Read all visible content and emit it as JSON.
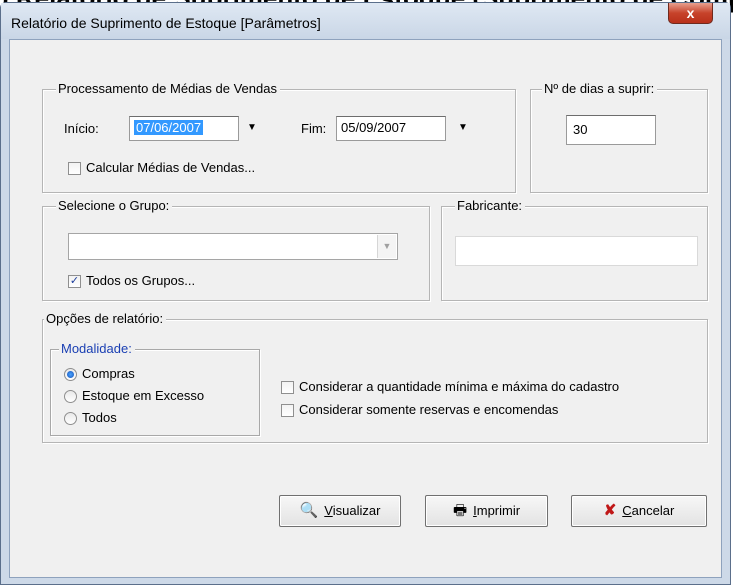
{
  "window": {
    "title": "Relatório de Suprimento de Estoque [Parâmetros]",
    "close_glyph": "x",
    "background_partial_text": ") Relatório de Suprimento de Estoque (Suprimento de Compras)"
  },
  "medias": {
    "legend": "Processamento de Médias de Vendas",
    "inicio_label": "Início:",
    "inicio_value": "07/06/2007",
    "fim_label": "Fim:",
    "fim_value": "05/09/2007",
    "calcular_label": "Calcular Médias de Vendas...",
    "calcular_checked": false
  },
  "dias": {
    "legend": "Nº de dias a suprir:",
    "value": "30"
  },
  "grupo": {
    "legend": "Selecione o Grupo:",
    "selected": "",
    "todos_label": "Todos os Grupos...",
    "todos_checked": true
  },
  "fabricante": {
    "legend": "Fabricante:",
    "value": ""
  },
  "opcoes": {
    "legend": "Opções de relatório:",
    "modalidade_legend": "Modalidade:",
    "radio_compras": "Compras",
    "radio_excesso": "Estoque em Excesso",
    "radio_todos": "Todos",
    "selected": "Compras",
    "check_minmax": "Considerar a quantidade mínima e máxima do cadastro",
    "check_reservas": "Considerar somente reservas e encomendas"
  },
  "buttons": {
    "visualizar_first": "V",
    "visualizar_rest": "isualizar",
    "imprimir_first": "I",
    "imprimir_rest": "mprimir",
    "cancelar_first": "C",
    "cancelar_rest": "ancelar"
  },
  "icons": {
    "checkmark": "✓",
    "dropdown": "▼",
    "combo_arrow": "▼",
    "zoom": "🔍",
    "printer": "🖶",
    "cancel_x": "✘"
  },
  "colors": {
    "legend_blue": "#1a3fb3",
    "selection": "#3399ff",
    "cancel_red": "#c01818"
  }
}
